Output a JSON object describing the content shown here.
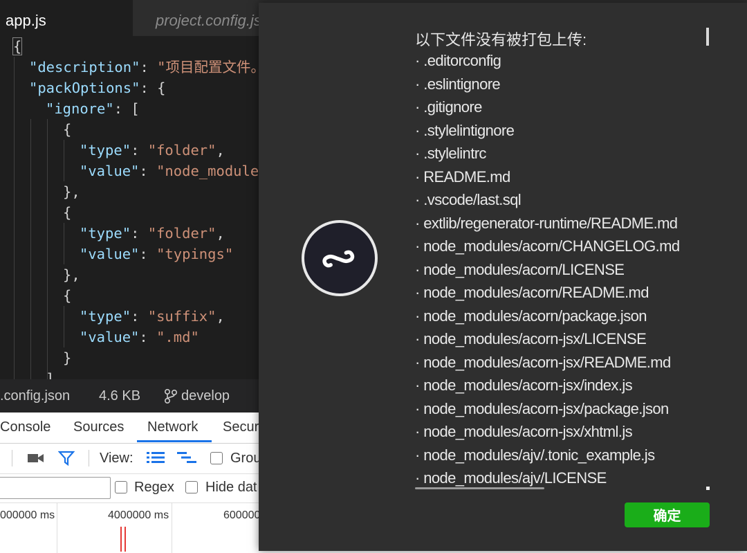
{
  "editor": {
    "tabs": [
      {
        "label": "app.js"
      },
      {
        "label": "project.config.js"
      }
    ]
  },
  "statusbar": {
    "file": ".config.json",
    "size": "4.6 KB",
    "branch_icon": "git-branch-icon",
    "branch": "develop"
  },
  "devtools": {
    "tabs": [
      "Console",
      "Sources",
      "Network",
      "Secur"
    ],
    "view_label": "View:",
    "group_label": "Grou",
    "regex_label": "Regex",
    "hide_label": "Hide dat",
    "timeline": [
      "000000 ms",
      "4000000 ms",
      "600000"
    ],
    "accent": "#1a73e8"
  },
  "modal": {
    "title": "以下文件没有被打包上传:",
    "files": [
      "· .editorconfig",
      "· .eslintignore",
      "· .gitignore",
      "· .stylelintignore",
      "· .stylelintrc",
      "· README.md",
      "· .vscode/last.sql",
      "· extlib/regenerator-runtime/README.md",
      "· node_modules/acorn/CHANGELOG.md",
      "· node_modules/acorn/LICENSE",
      "· node_modules/acorn/README.md",
      "· node_modules/acorn/package.json",
      "· node_modules/acorn-jsx/LICENSE",
      "· node_modules/acorn-jsx/README.md",
      "· node_modules/acorn-jsx/index.js",
      "· node_modules/acorn-jsx/package.json",
      "· node_modules/acorn-jsx/xhtml.js",
      "· node_modules/ajv/.tonic_example.js",
      "· node_modules/ajv/LICENSE"
    ],
    "confirm_label": "确定",
    "confirm_color": "#1aad19",
    "logo_icon": "mini-program-logo-icon"
  }
}
